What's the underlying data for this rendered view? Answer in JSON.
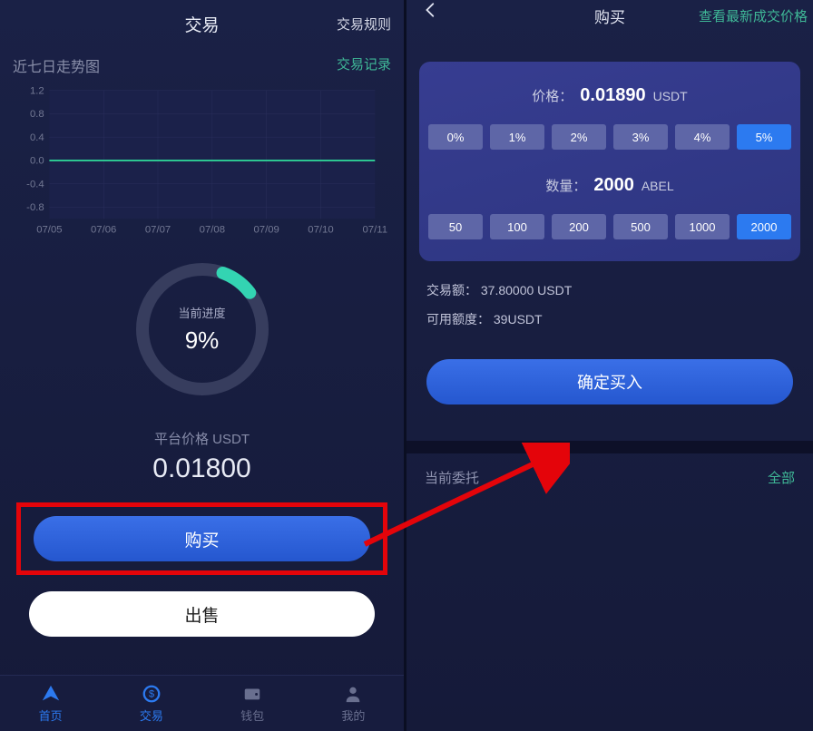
{
  "left": {
    "title": "交易",
    "header_right": "交易规则",
    "chart_caption": "近七日走势图",
    "trade_record": "交易记录",
    "chart_data": {
      "type": "line",
      "categories": [
        "07/05",
        "07/06",
        "07/07",
        "07/08",
        "07/09",
        "07/10",
        "07/11"
      ],
      "values": [
        0,
        0,
        0,
        0,
        0,
        0,
        0
      ],
      "yticks": [
        -0.8,
        -0.4,
        0.0,
        0.4,
        0.8,
        1.2
      ],
      "ylim": [
        -1.0,
        1.2
      ]
    },
    "progress_label": "当前进度",
    "progress_value": "9%",
    "price_label": "平台价格 USDT",
    "price_value": "0.01800",
    "buy_button": "购买",
    "sell_button": "出售",
    "nav": [
      {
        "label": "首页",
        "icon": "home"
      },
      {
        "label": "交易",
        "icon": "trade"
      },
      {
        "label": "钱包",
        "icon": "wallet"
      },
      {
        "label": "我的",
        "icon": "user"
      }
    ]
  },
  "right": {
    "title": "购买",
    "header_link": "查看最新成交价格",
    "price_label": "价格：",
    "price_value": "0.01890",
    "price_unit": "USDT",
    "pct_chips": [
      "0%",
      "1%",
      "2%",
      "3%",
      "4%",
      "5%"
    ],
    "pct_active_index": 5,
    "qty_label": "数量：",
    "qty_value": "2000",
    "qty_unit": "ABEL",
    "qty_chips": [
      "50",
      "100",
      "200",
      "500",
      "1000",
      "2000"
    ],
    "qty_active_index": 5,
    "amount_label": "交易额：",
    "amount_value": "37.80000 USDT",
    "avail_label": "可用额度：",
    "avail_value": "39USDT",
    "confirm_button": "确定买入",
    "orders_label": "当前委托",
    "orders_all": "全部"
  }
}
